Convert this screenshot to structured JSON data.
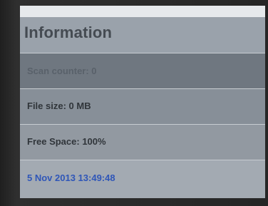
{
  "header": {
    "title": "Information"
  },
  "info_rows": [
    {
      "label": "Scan counter: 0"
    },
    {
      "label": "File size: 0 MB"
    },
    {
      "label": "Free Space: 100%"
    }
  ],
  "status": {
    "timestamp": "5 Nov 2013 13:49:48"
  },
  "colors": {
    "timestamp": "#2f56b8",
    "header_text": "#454b52"
  }
}
